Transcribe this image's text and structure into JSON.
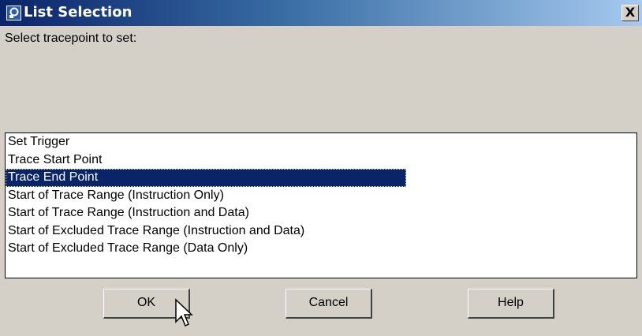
{
  "window": {
    "title": "List Selection",
    "close_glyph": "X",
    "icon": "app-icon"
  },
  "prompt": "Select tracepoint to set:",
  "list": {
    "items": [
      "Set Trigger",
      "Trace Start Point",
      "Trace End Point",
      "Start of Trace Range (Instruction Only)",
      "Start of Trace Range (Instruction and Data)",
      "Start of Excluded Trace Range (Instruction and Data)",
      "Start of Excluded Trace Range (Data Only)"
    ],
    "selected": "Trace End Point"
  },
  "buttons": {
    "ok": "OK",
    "cancel": "Cancel",
    "help": "Help"
  },
  "colors": {
    "title_bar": "#0a246a",
    "selection": "#0a246a",
    "dialog_bg": "#d4d0c8"
  }
}
